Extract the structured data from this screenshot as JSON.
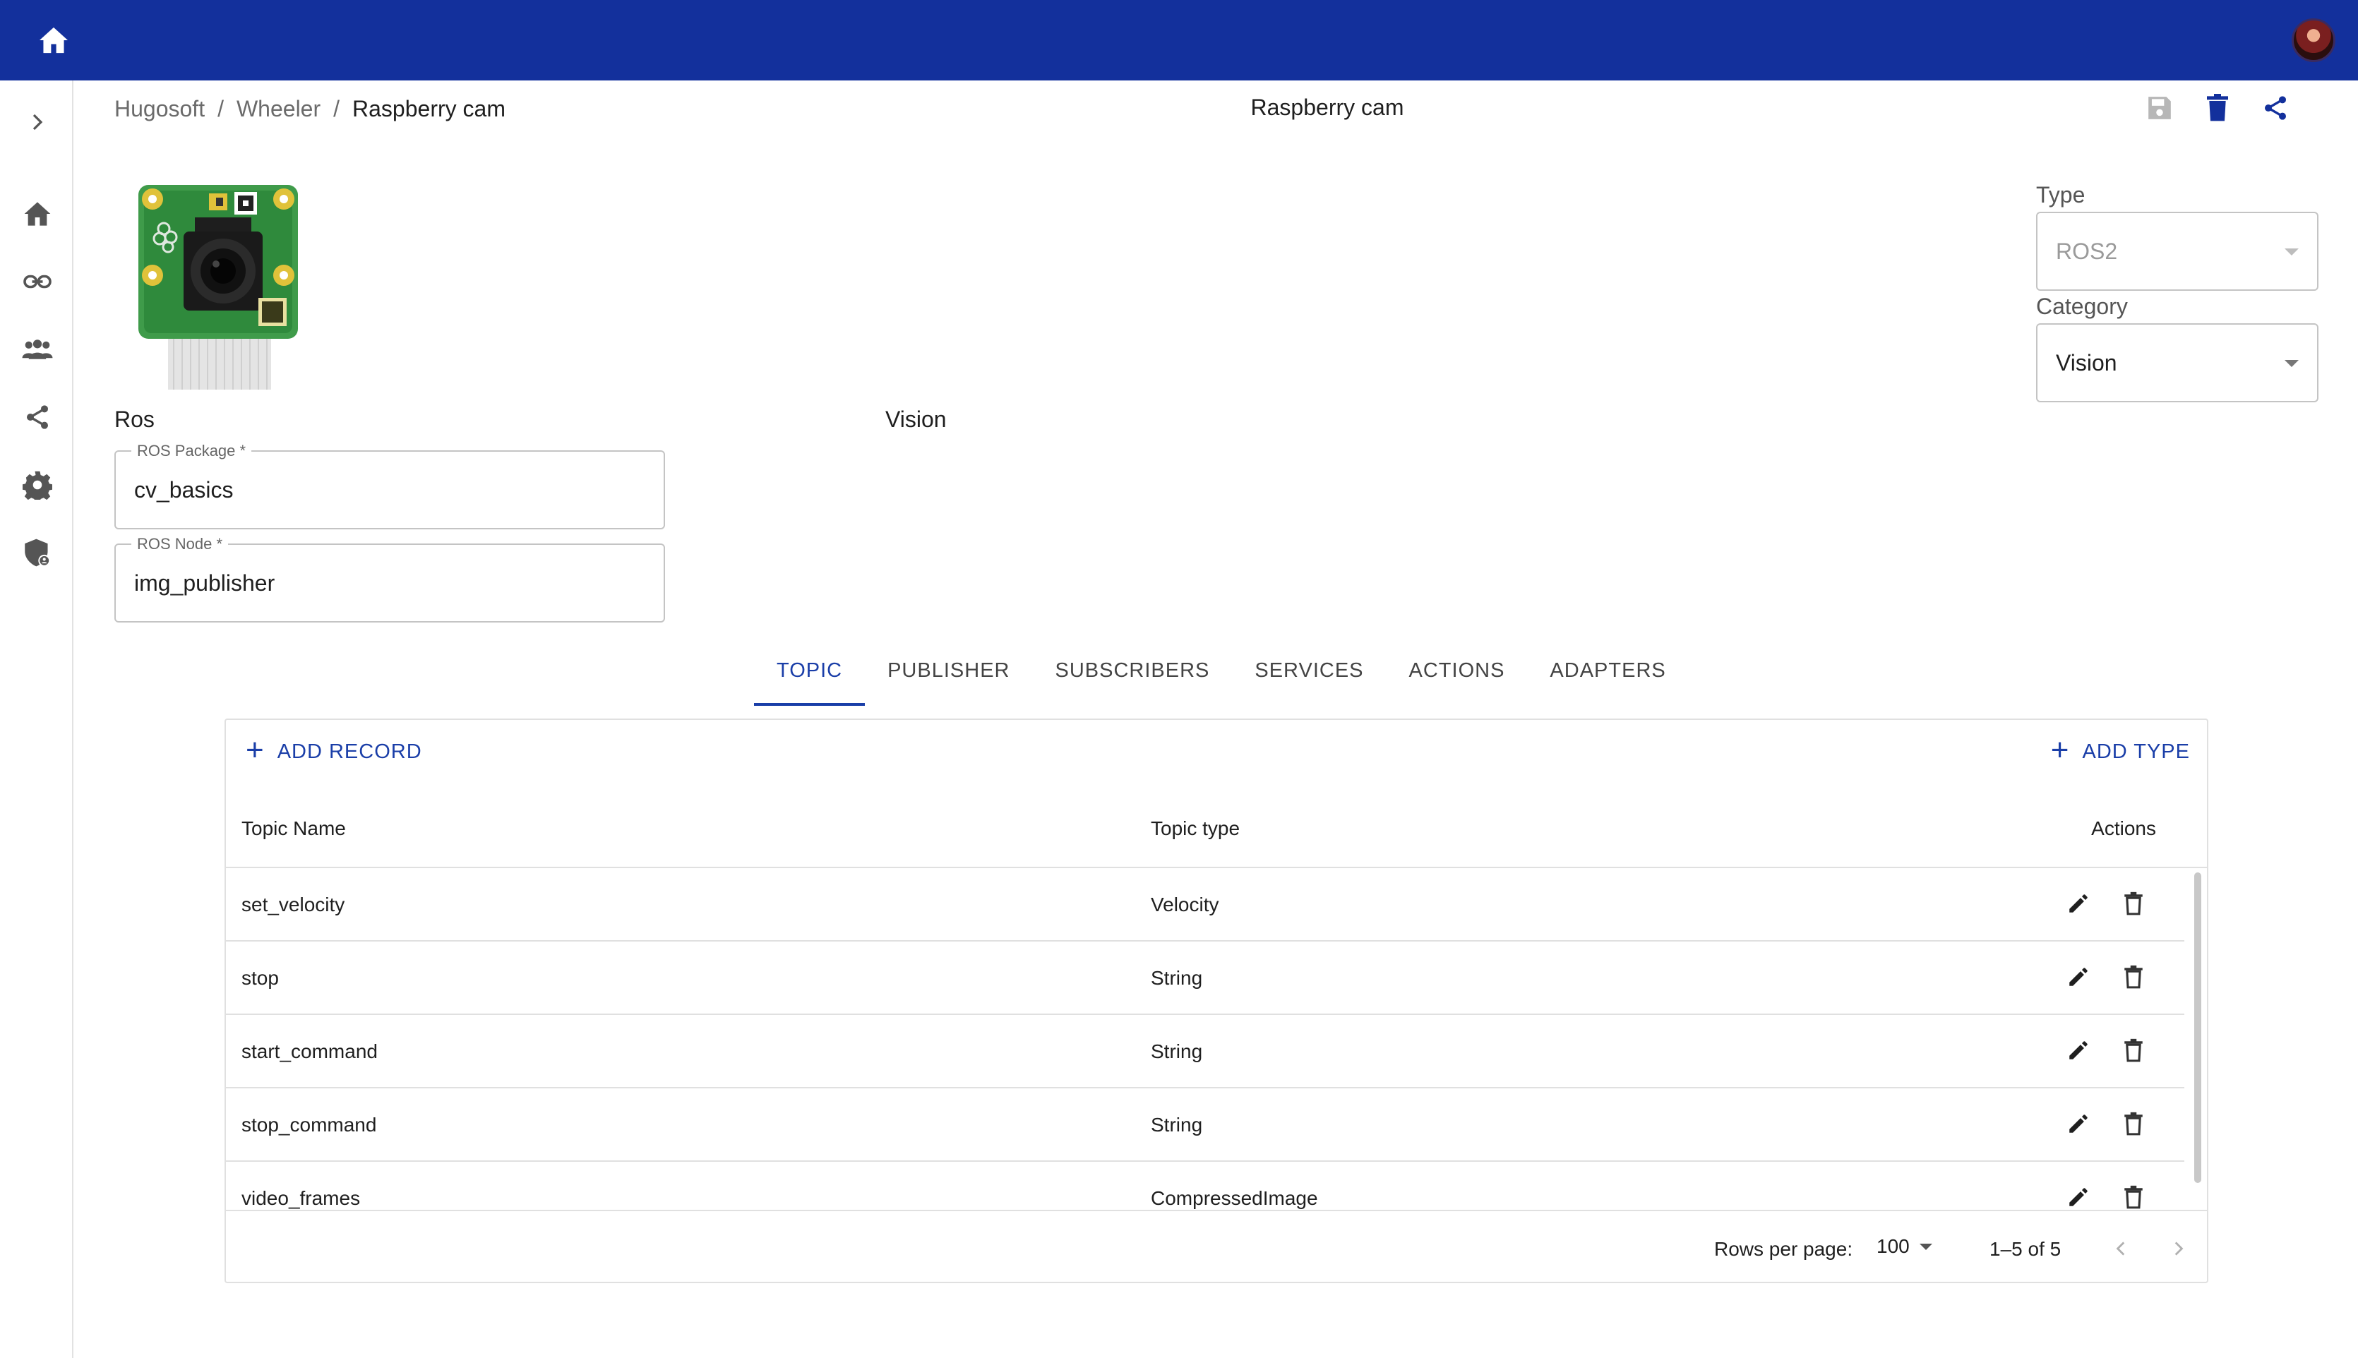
{
  "app": {
    "brand_color": "#13309c",
    "accent_color": "#1a3ea8"
  },
  "breadcrumb": {
    "items": [
      "Hugosoft",
      "Wheeler"
    ],
    "separator": "/",
    "current": "Raspberry cam"
  },
  "header": {
    "title": "Raspberry cam"
  },
  "top_actions": [
    "save-icon",
    "delete-icon",
    "share-icon"
  ],
  "sidebar": {
    "items": [
      "chevron-right-icon",
      "home-icon",
      "link-icon",
      "group-icon",
      "share-icon",
      "settings-icon",
      "admin-shield-icon"
    ]
  },
  "device": {
    "image_icon": "raspberry-camera-module-image",
    "type_label": "Ros",
    "category_label": "Vision"
  },
  "fields": {
    "ros_package": {
      "label": "ROS Package *",
      "value": "cv_basics"
    },
    "ros_node": {
      "label": "ROS Node *",
      "value": "img_publisher"
    }
  },
  "selects": {
    "type": {
      "label": "Type",
      "value": "ROS2",
      "disabled": true
    },
    "category": {
      "label": "Category",
      "value": "Vision"
    }
  },
  "tabs": [
    "TOPIC",
    "PUBLISHER",
    "SUBSCRIBERS",
    "SERVICES",
    "ACTIONS",
    "ADAPTERS"
  ],
  "active_tab": "TOPIC",
  "grid": {
    "add_record": "ADD RECORD",
    "add_type": "ADD TYPE",
    "columns": [
      "Topic Name",
      "Topic type",
      "Actions"
    ],
    "rows": [
      {
        "name": "set_velocity",
        "type": "Velocity"
      },
      {
        "name": "stop",
        "type": "String"
      },
      {
        "name": "start_command",
        "type": "String"
      },
      {
        "name": "stop_command",
        "type": "String"
      },
      {
        "name": "video_frames",
        "type": "CompressedImage"
      }
    ],
    "footer": {
      "rows_per_page_label": "Rows per page:",
      "rows_per_page": "100",
      "range": "1–5 of 5"
    }
  }
}
